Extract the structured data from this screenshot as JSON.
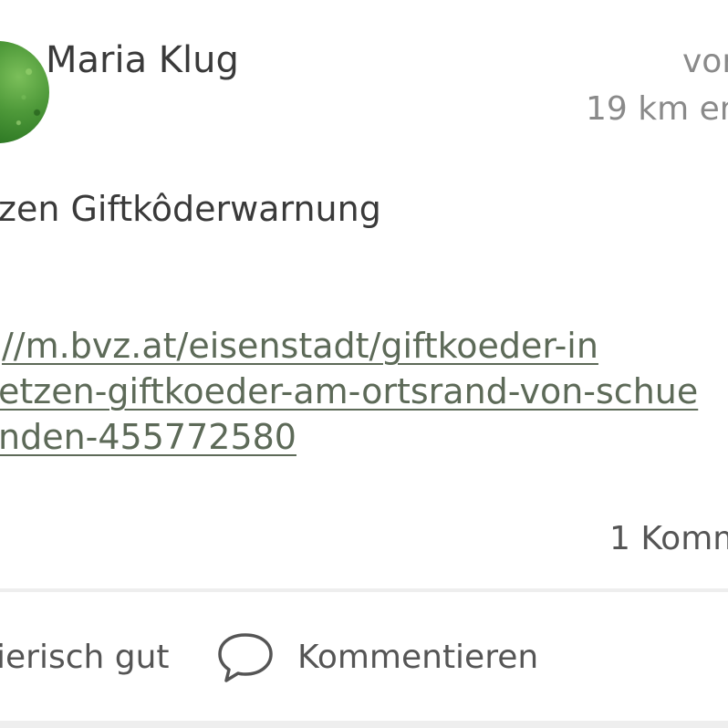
{
  "post": {
    "author": "Maria Klug",
    "meta_top": "vor",
    "distance": "19 km en",
    "title": "zen Giftkôderwarnung",
    "link_lines": [
      "//m.bvz.at/eisenstadt/giftkoeder-in",
      "etzen-giftkoeder-am-ortsrand-von-schue",
      "nden-455772580"
    ],
    "comment_count": "1 Komm"
  },
  "actions": {
    "like_label": "ierisch gut",
    "comment_label": "Kommentieren",
    "comment_icon": "speech-bubble-icon"
  },
  "colors": {
    "text": "#3a3a3a",
    "muted": "#8a8a8a",
    "link": "#5d6a58",
    "divider": "#eeeeee",
    "avatar": "#4f9a3a"
  }
}
